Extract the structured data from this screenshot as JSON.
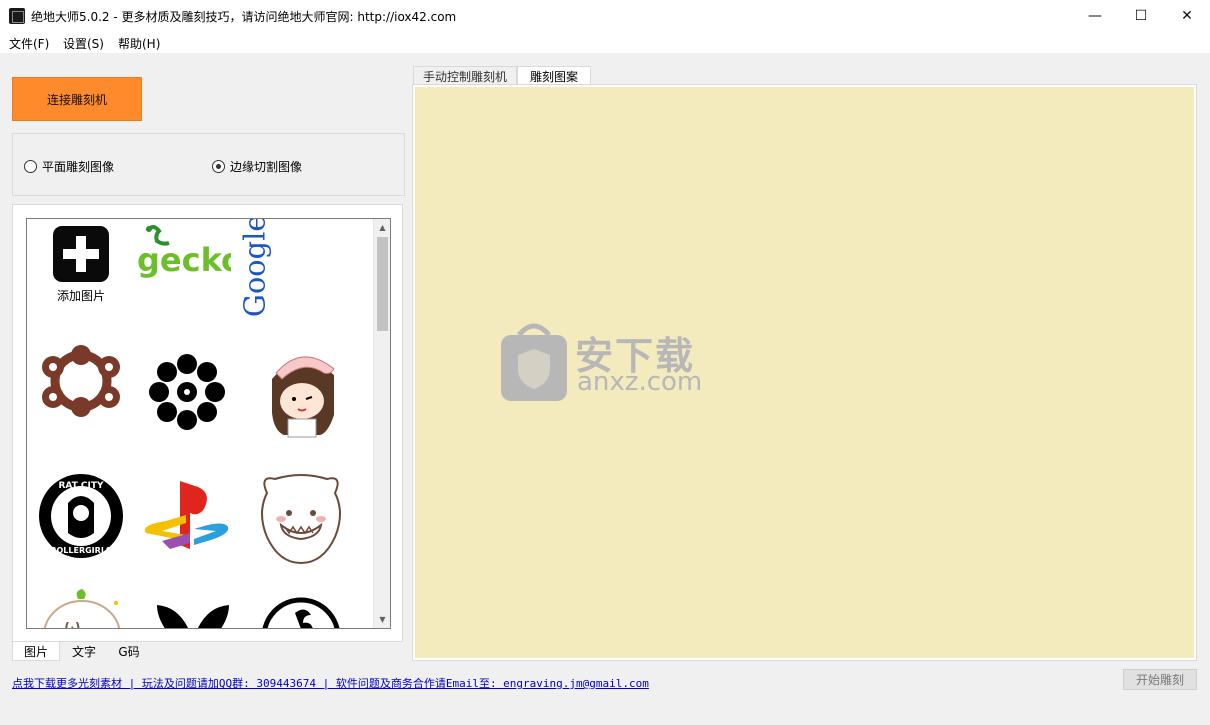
{
  "window": {
    "title": "绝地大师5.0.2 - 更多材质及雕刻技巧，请访问绝地大师官网: http://iox42.com",
    "minimize_glyph": "—",
    "maximize_glyph": "☐",
    "close_glyph": "✕"
  },
  "menu": {
    "file": "文件(F)",
    "settings": "设置(S)",
    "help": "帮助(H)"
  },
  "sidebar": {
    "connect_button": "连接雕刻机",
    "modes": [
      {
        "label": "平面雕刻图像",
        "selected": false
      },
      {
        "label": "边缘切割图像",
        "selected": true
      }
    ],
    "gallery": {
      "add_label": "添加图片",
      "items": [
        "add-image",
        "gecko-logo",
        "google-logo",
        "gear-ring",
        "flower-shape",
        "cartoon-girl",
        "rat-city-rollergirls",
        "playstation-logo",
        "cartoon-monster",
        "cartoon-bun",
        "butterfly",
        "circle-logo"
      ],
      "logo_texts": {
        "gecko": "gecko",
        "google": "Google",
        "rat_city_top": "RAT CITY",
        "rat_city_bottom": "ROLLERGIRLS"
      }
    },
    "bottom_tabs": [
      {
        "label": "图片",
        "active": true
      },
      {
        "label": "文字",
        "active": false
      },
      {
        "label": "G码",
        "active": false
      }
    ]
  },
  "main": {
    "tabs": [
      {
        "label": "手动控制雕刻机",
        "active": false
      },
      {
        "label": "雕刻图案",
        "active": true
      }
    ],
    "canvas_color": "#f3eabd",
    "watermark": {
      "title": "安下载",
      "subtitle": "anxz.com"
    }
  },
  "footer": {
    "links": "点我下载更多光刻素材 | 玩法及问题请加QQ群: 309443674 | 软件问题及商务合作请Email至: engraving.jm@gmail.com",
    "start_button": "开始雕刻"
  },
  "colors": {
    "accent_orange": "#ff8a2b",
    "link_blue": "#0000c8"
  }
}
